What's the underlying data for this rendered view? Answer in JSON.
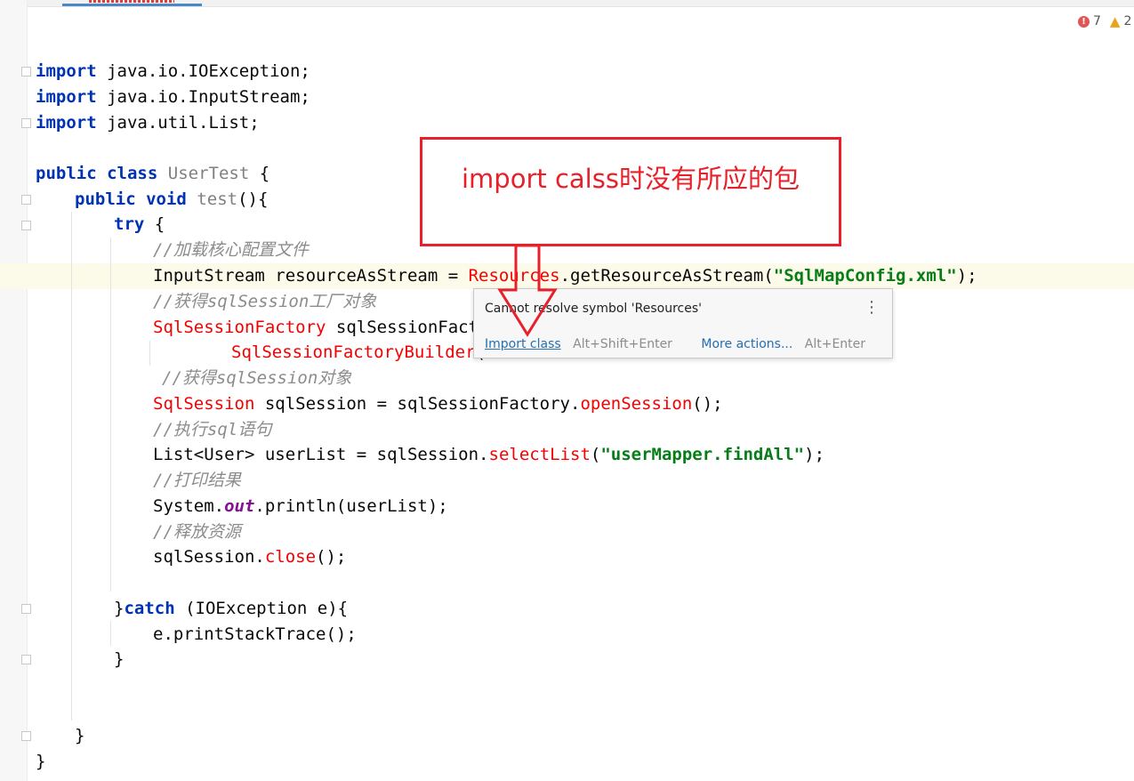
{
  "inspection": {
    "errors": "7",
    "warnings": "2"
  },
  "code": {
    "l1": {
      "kw": "import",
      "rest": " java.io.IOException;"
    },
    "l2": {
      "kw": "import",
      "rest": " java.io.InputStream;"
    },
    "l3": {
      "kw": "import",
      "rest": " java.util.List;"
    },
    "l4": {
      "kw1": "public",
      "kw2": "class",
      "cls": "UserTest",
      "rest": " {"
    },
    "l5": {
      "kw1": "public",
      "kw2": "void",
      "method": "test",
      "rest": "(){"
    },
    "l6": {
      "kw": "try",
      "rest": " {"
    },
    "l7": {
      "comment": "//加载核心配置文件"
    },
    "l8": {
      "pre": "InputStream resourceAsStream = ",
      "err": "Resources",
      "mid": ".getResourceAsStream(",
      "str": "\"SqlMapConfig.xml\"",
      "post": ");"
    },
    "l9": {
      "comment": "//获得sqlSession工厂对象"
    },
    "l10": {
      "err": "SqlSessionFactory",
      "rest": " sqlSessionFacto"
    },
    "l11": {
      "err": "SqlSessionFactoryBuilder",
      "rest": "("
    },
    "l12": {
      "comment": "//获得sqlSession对象"
    },
    "l13": {
      "err": "SqlSession",
      "pre": " sqlSession = sqlSessionFactory.",
      "method": "openSession",
      "post": "();"
    },
    "l14": {
      "comment": "//执行sql语句"
    },
    "l15": {
      "pre": "List<User> userList = sqlSession.",
      "method": "selectList",
      "mid": "(",
      "str": "\"userMapper.findAll\"",
      "post": ");"
    },
    "l16": {
      "comment": "//打印结果"
    },
    "l17": {
      "pre": "System.",
      "field": "out",
      "post": ".println(userList);"
    },
    "l18": {
      "comment": "//释放资源"
    },
    "l19": {
      "pre": "sqlSession.",
      "method": "close",
      "post": "();"
    },
    "l20": {
      "pre": "}",
      "kw": "catch",
      "post": " (IOException e){"
    },
    "l21": {
      "text": "e.printStackTrace();"
    },
    "l22": {
      "text": "}"
    },
    "l23": {
      "text": "}"
    },
    "l24": {
      "text": "}"
    }
  },
  "popup": {
    "message": "Cannot resolve symbol 'Resources'",
    "import_label": "Import class",
    "import_shortcut": "Alt+Shift+Enter",
    "more_label": "More actions...",
    "more_shortcut": "Alt+Enter"
  },
  "annotation": {
    "text": "import calss时没有所应的包",
    "color": "#e8202a"
  }
}
